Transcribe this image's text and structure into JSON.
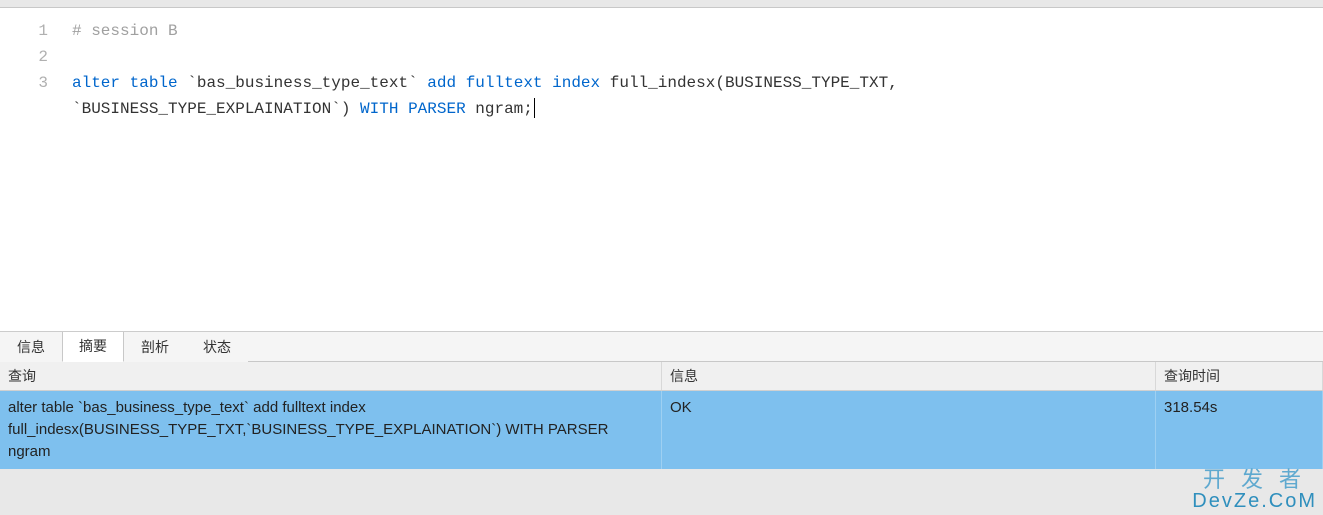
{
  "editor": {
    "lines": [
      "1",
      "2",
      "3"
    ],
    "t1a": "# session B",
    "t3_kw1": "alter",
    "t3_kw2": "table",
    "t3_p1": " `bas_business_type_text` ",
    "t3_kw3": "add",
    "t3_kw4": "fulltext",
    "t3_kw5": "index",
    "t3_p2": " full_indesx(BUSINESS_TYPE_TXT,\n`BUSINESS_TYPE_EXPLAINATION`) ",
    "t3_kw6": "WITH",
    "t3_kw7": "PARSER",
    "t3_p3": " ngram;"
  },
  "tabs": {
    "t0": "信息",
    "t1": "摘要",
    "t2": "剖析",
    "t3": "状态"
  },
  "results": {
    "headers": {
      "h1": "查询",
      "h2": "信息",
      "h3": "查询时间"
    },
    "row": {
      "query": "alter table `bas_business_type_text` add fulltext index full_indesx(BUSINESS_TYPE_TXT,`BUSINESS_TYPE_EXPLAINATION`) WITH PARSER ngram",
      "info": "OK",
      "time": "318.54s"
    }
  },
  "watermark": {
    "l1": "开发者",
    "l2": "DevZe.CoM"
  }
}
